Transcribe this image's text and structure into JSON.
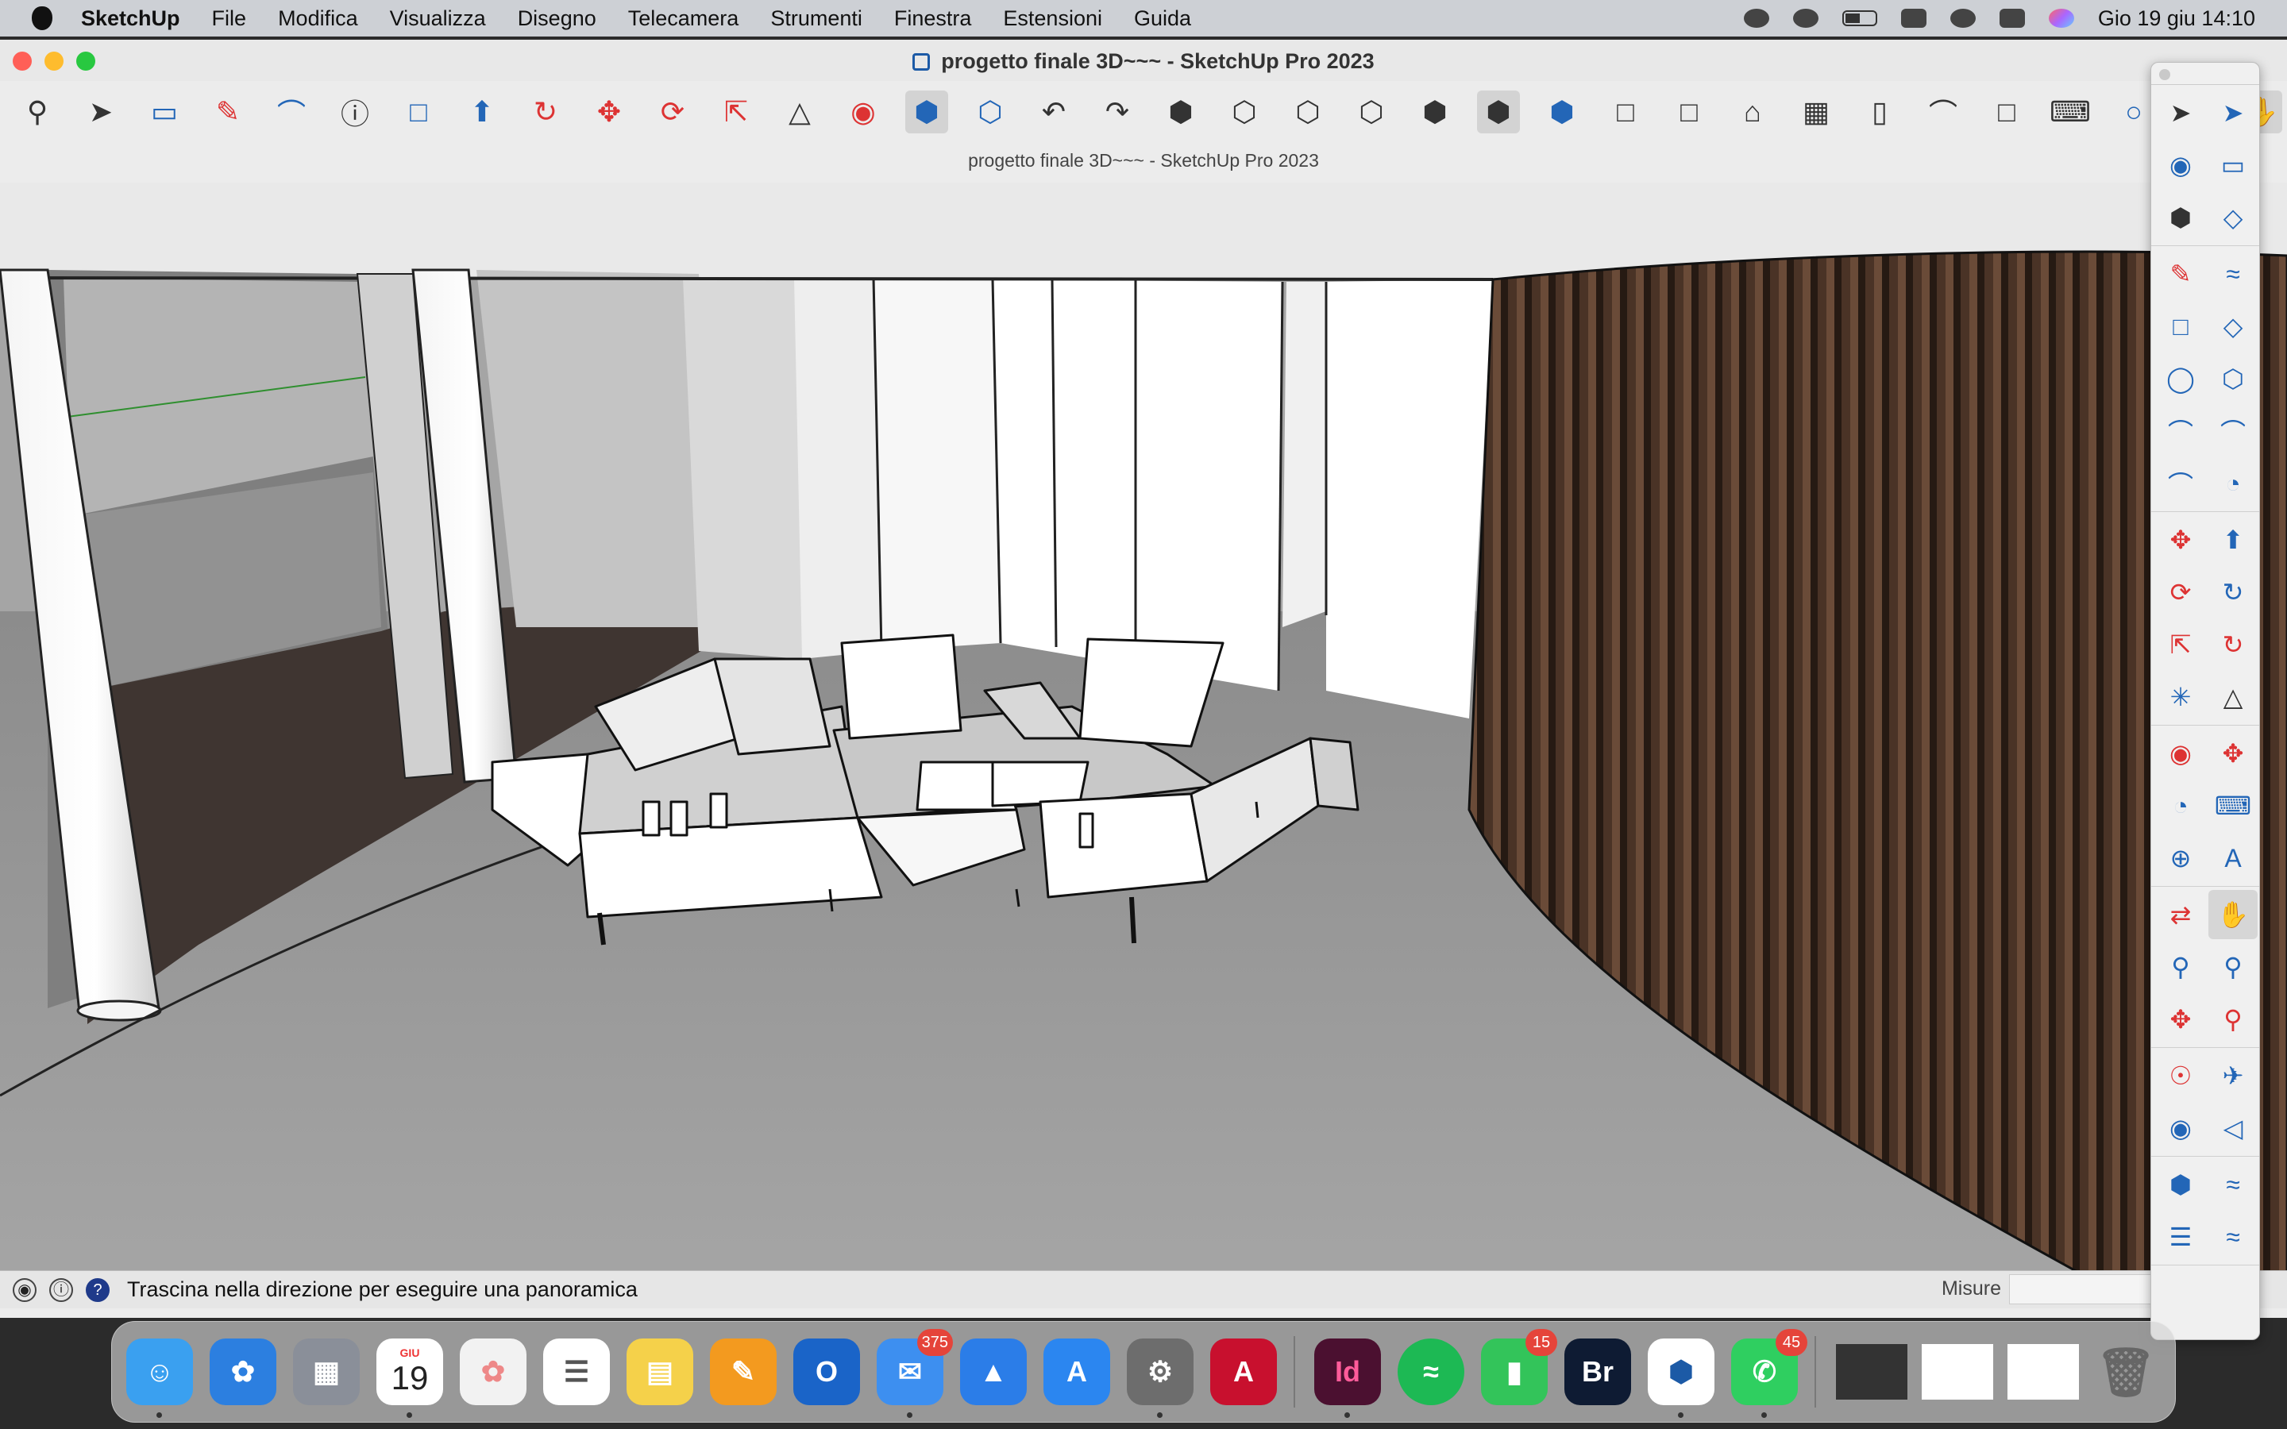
{
  "menubar": {
    "app": "SketchUp",
    "items": [
      "File",
      "Modifica",
      "Visualizza",
      "Disegno",
      "Telecamera",
      "Strumenti",
      "Finestra",
      "Estensioni",
      "Guida"
    ],
    "status_icons": [
      "creative-cloud-icon",
      "play-icon",
      "battery-icon",
      "wifi-icon",
      "search-icon",
      "control-center-icon",
      "siri-icon"
    ],
    "clock": "Gio 19 giu  14:10"
  },
  "window": {
    "title": "progetto finale 3D~~~ - SketchUp Pro 2023",
    "subtitle": "progetto finale 3D~~~ - SketchUp Pro 2023",
    "traffic_colors": [
      "#ff5f57",
      "#febc2e",
      "#28c840"
    ]
  },
  "toolbar": {
    "icons": [
      "search-icon",
      "select-icon",
      "dropdown-icon",
      "eraser-icon",
      "pencil-icon",
      "dropdown-icon",
      "arc-icon",
      "dropdown-icon",
      "info-icon",
      "rectangle-icon",
      "dropdown-icon",
      "push-pull-icon",
      "follow-me-icon",
      "move-icon",
      "rotate-icon",
      "scale-icon",
      "flip-icon",
      "paint-icon",
      "component-icon",
      "section-icon",
      "undo-icon",
      "redo-icon",
      "iso-view-icon",
      "top-view-icon",
      "front-view-icon",
      "right-view-icon",
      "back-view-icon",
      "left-view-icon",
      "bottom-view-icon",
      "xray-icon",
      "wireframe-icon",
      "hidden-line-icon",
      "shaded-icon",
      "textured-icon",
      "monochrome-icon",
      "3d-text-icon",
      "tape-icon",
      "dimension-icon",
      "pan-icon"
    ]
  },
  "status": {
    "message": "Trascina nella direzione per eseguire una panoramica",
    "measure_label": "Misure",
    "measure_value": ""
  },
  "tray": {
    "groups": [
      [
        "select-icon",
        "lasso-icon",
        "paint-icon",
        "eraser-icon",
        "component-icon",
        "tag-eraser-icon"
      ],
      [
        "line-icon",
        "freehand-icon",
        "rectangle-icon",
        "rotated-rectangle-icon",
        "circle-icon",
        "polygon-icon",
        "arc-icon",
        "2pt-arc-icon",
        "3pt-arc-icon",
        "pie-icon"
      ],
      [
        "move-icon",
        "push-pull-icon",
        "rotate-icon",
        "follow-me-icon",
        "scale-icon",
        "offset-icon",
        "flip-icon",
        "mirror-icon"
      ],
      [
        "tape-measure-icon",
        "dimension-icon",
        "protractor-icon",
        "text-icon",
        "axes-icon",
        "3d-text-icon"
      ],
      [
        "orbit-icon",
        "pan-icon",
        "zoom-icon",
        "zoom-window-icon",
        "zoom-extents-icon",
        "zoom-previous-icon"
      ],
      [
        "position-camera-icon",
        "walk-icon",
        "look-around-icon",
        "section-plane-icon"
      ],
      [
        "solid-tools-icon",
        "sandbox-icon",
        "layers-icon",
        "styles-icon"
      ]
    ]
  },
  "dock": {
    "apps": [
      {
        "name": "finder",
        "color": "#3aa0f0"
      },
      {
        "name": "safari",
        "color": "#2c7fe0"
      },
      {
        "name": "launchpad",
        "color": "#8a8f99"
      },
      {
        "name": "calendar",
        "color": "#ffffff",
        "month": "GIU",
        "day": "19"
      },
      {
        "name": "photos",
        "color": "#f2f2f2"
      },
      {
        "name": "reminders",
        "color": "#ffffff"
      },
      {
        "name": "notes",
        "color": "#f5d14a"
      },
      {
        "name": "pages",
        "color": "#f39a1f"
      },
      {
        "name": "outlook",
        "color": "#1a64c8"
      },
      {
        "name": "mail",
        "color": "#3d8ff0",
        "badge": "375"
      },
      {
        "name": "keynote",
        "color": "#2b7de8"
      },
      {
        "name": "app-store",
        "color": "#2b86f0"
      },
      {
        "name": "system-settings",
        "color": "#6d6d6d"
      },
      {
        "name": "autocad",
        "color": "#c8102e",
        "label": "A"
      },
      {
        "name": "indesign",
        "color": "#4b1030",
        "label": "Id"
      },
      {
        "name": "spotify",
        "color": "#1db954"
      },
      {
        "name": "facetime",
        "color": "#33c45a",
        "badge": "15"
      },
      {
        "name": "bridge",
        "color": "#0e1b33",
        "label": "Br"
      },
      {
        "name": "sketchup",
        "color": "#ffffff"
      },
      {
        "name": "whatsapp",
        "color": "#2fcf60",
        "badge": "45"
      }
    ]
  }
}
